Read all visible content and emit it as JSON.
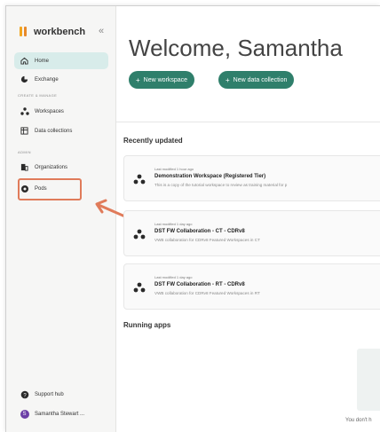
{
  "brand": {
    "name": "workbench"
  },
  "sidebar": {
    "items_top": [
      {
        "label": "Home",
        "icon": "home-icon",
        "active": true
      },
      {
        "label": "Exchange",
        "icon": "exchange-icon",
        "active": false
      }
    ],
    "create_manage_label": "CREATE & MANAGE",
    "items_create": [
      {
        "label": "Workspaces",
        "icon": "workspaces-icon"
      },
      {
        "label": "Data collections",
        "icon": "data-collections-icon"
      }
    ],
    "admin_label": "ADMIN",
    "items_admin": [
      {
        "label": "Organizations",
        "icon": "organizations-icon"
      },
      {
        "label": "Pods",
        "icon": "pods-icon"
      }
    ],
    "support_hub": "Support hub",
    "user_name": "Samantha Stewart ..."
  },
  "main": {
    "welcome": "Welcome, Samantha",
    "new_workspace_btn": "New workspace",
    "new_data_collection_btn": "New data collection",
    "recently_updated": "Recently updated",
    "cards": [
      {
        "modified": "Last modified 1 hour ago",
        "title": "Demonstration Workspace (Registered Tier)",
        "desc": "This is a copy of the tutorial workspace to review as training material for p"
      },
      {
        "modified": "Last modified 1 day ago",
        "title": "DST FW Collaboration - CT - CDRv8",
        "desc": "VWB collaboration for CDRv8 Featured Workspaces in CT"
      },
      {
        "modified": "Last modified 1 day ago",
        "title": "DST FW Collaboration - RT - CDRv8",
        "desc": "VWB collaboration for CDRv8 Featured Workspaces in RT"
      }
    ],
    "running_apps": "Running apps",
    "empty_text": "You don't h"
  },
  "colors": {
    "accent": "#2f7f6b",
    "active_nav": "#d8ecea",
    "highlight": "#e07b5a"
  }
}
